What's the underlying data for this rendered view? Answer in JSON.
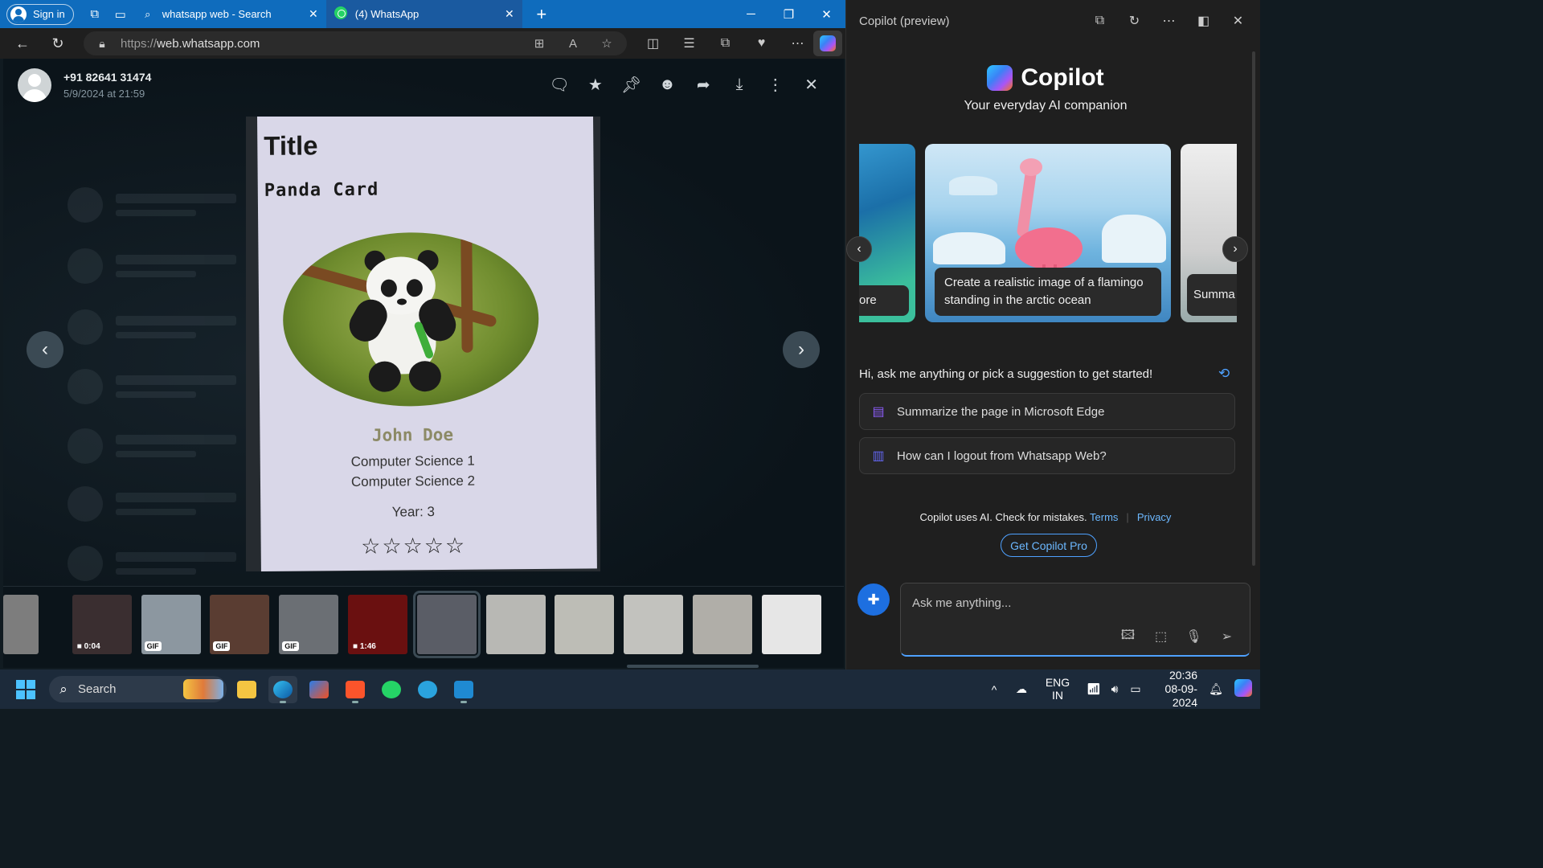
{
  "browser": {
    "signin_label": "Sign in",
    "tabs": [
      {
        "title": "whatsapp web - Search",
        "icon": "search-icon"
      },
      {
        "title": "(4) WhatsApp",
        "icon": "whatsapp-icon",
        "active": true
      }
    ],
    "url_prefix": "https://",
    "url_host": "web.whatsapp.com"
  },
  "viewer": {
    "sender_name": "+91 82641 31474",
    "sender_time": "5/9/2024 at 21:59",
    "actions": [
      "reply-icon",
      "star-icon",
      "pin-icon",
      "emoji-icon",
      "forward-icon",
      "download-icon",
      "more-icon",
      "close-icon"
    ],
    "card": {
      "title": "Title",
      "subtitle": "Panda Card",
      "name": "John Doe",
      "line1": "Computer Science 1",
      "line2": "Computer Science 2",
      "year": "Year: 3",
      "stars": "☆☆☆☆☆"
    },
    "thumbnails": [
      {
        "kind": "image",
        "color": "#7d7d7d"
      },
      {
        "kind": "video",
        "label": "0:04",
        "color": "#3a2e30"
      },
      {
        "kind": "gif",
        "label": "GIF",
        "color": "#8c97a0"
      },
      {
        "kind": "gif",
        "label": "GIF",
        "color": "#5a3d32"
      },
      {
        "kind": "gif",
        "label": "GIF",
        "color": "#6b6f74"
      },
      {
        "kind": "video",
        "label": "1:46",
        "color": "#6a1010"
      },
      {
        "kind": "image",
        "color": "#5a5d66",
        "selected": true
      },
      {
        "kind": "image",
        "color": "#b8b8b4"
      },
      {
        "kind": "image",
        "color": "#bdbdb6"
      },
      {
        "kind": "image",
        "color": "#c2c2be"
      },
      {
        "kind": "image",
        "color": "#b0aea8"
      },
      {
        "kind": "image",
        "color": "#e6e6e6"
      }
    ]
  },
  "copilot": {
    "header": "Copilot (preview)",
    "brand": "Copilot",
    "tagline": "Your everyday AI companion",
    "slides": {
      "left_caption": "ore",
      "center_caption": "Create a realistic image of a flamingo standing in the arctic ocean",
      "right_caption": "Summa"
    },
    "prompt": "Hi, ask me anything or pick a suggestion to get started!",
    "suggestions": [
      {
        "label": "Summarize the page in Microsoft Edge",
        "icon": "page-icon",
        "color": "#8b5cf6"
      },
      {
        "label": "How can I logout from Whatsapp Web?",
        "icon": "books-icon",
        "color": "#6366f1"
      }
    ],
    "disclaimer": "Copilot uses AI. Check for mistakes.",
    "terms": "Terms",
    "privacy": "Privacy",
    "pro_button": "Get Copilot Pro",
    "input_placeholder": "Ask me anything..."
  },
  "taskbar": {
    "search_label": "Search",
    "lang_1": "ENG",
    "lang_2": "IN",
    "time": "20:36",
    "date": "08-09-2024"
  },
  "colors": {
    "accent": "#0f6cbd",
    "whatsapp_bg": "#0b141a",
    "copilot_link": "#6cb8ff"
  }
}
